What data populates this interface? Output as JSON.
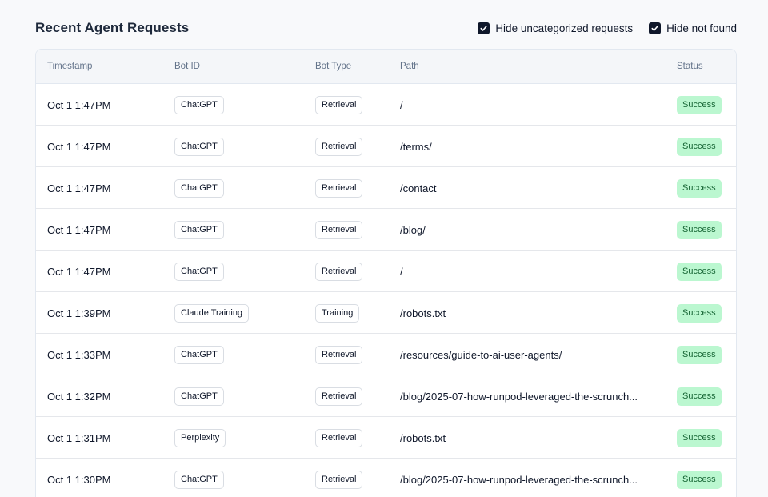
{
  "header": {
    "title": "Recent Agent Requests",
    "filters": [
      {
        "label": "Hide uncategorized requests",
        "checked": true
      },
      {
        "label": "Hide not found",
        "checked": true
      }
    ]
  },
  "table": {
    "columns": [
      "Timestamp",
      "Bot ID",
      "Bot Type",
      "Path",
      "Status"
    ],
    "rows": [
      {
        "timestamp": "Oct 1 1:47PM",
        "bot_id": "ChatGPT",
        "bot_type": "Retrieval",
        "path": "/",
        "status": "Success"
      },
      {
        "timestamp": "Oct 1 1:47PM",
        "bot_id": "ChatGPT",
        "bot_type": "Retrieval",
        "path": "/terms/",
        "status": "Success"
      },
      {
        "timestamp": "Oct 1 1:47PM",
        "bot_id": "ChatGPT",
        "bot_type": "Retrieval",
        "path": "/contact",
        "status": "Success"
      },
      {
        "timestamp": "Oct 1 1:47PM",
        "bot_id": "ChatGPT",
        "bot_type": "Retrieval",
        "path": "/blog/",
        "status": "Success"
      },
      {
        "timestamp": "Oct 1 1:47PM",
        "bot_id": "ChatGPT",
        "bot_type": "Retrieval",
        "path": "/",
        "status": "Success"
      },
      {
        "timestamp": "Oct 1 1:39PM",
        "bot_id": "Claude Training",
        "bot_type": "Training",
        "path": "/robots.txt",
        "status": "Success"
      },
      {
        "timestamp": "Oct 1 1:33PM",
        "bot_id": "ChatGPT",
        "bot_type": "Retrieval",
        "path": "/resources/guide-to-ai-user-agents/",
        "status": "Success"
      },
      {
        "timestamp": "Oct 1 1:32PM",
        "bot_id": "ChatGPT",
        "bot_type": "Retrieval",
        "path": "/blog/2025-07-how-runpod-leveraged-the-scrunch...",
        "status": "Success"
      },
      {
        "timestamp": "Oct 1 1:31PM",
        "bot_id": "Perplexity",
        "bot_type": "Retrieval",
        "path": "/robots.txt",
        "status": "Success"
      },
      {
        "timestamp": "Oct 1 1:30PM",
        "bot_id": "ChatGPT",
        "bot_type": "Retrieval",
        "path": "/blog/2025-07-how-runpod-leveraged-the-scrunch...",
        "status": "Success"
      }
    ]
  },
  "colors": {
    "success_bg": "#bbf7d0",
    "success_text": "#166534",
    "checkbox": "#0f172a"
  }
}
